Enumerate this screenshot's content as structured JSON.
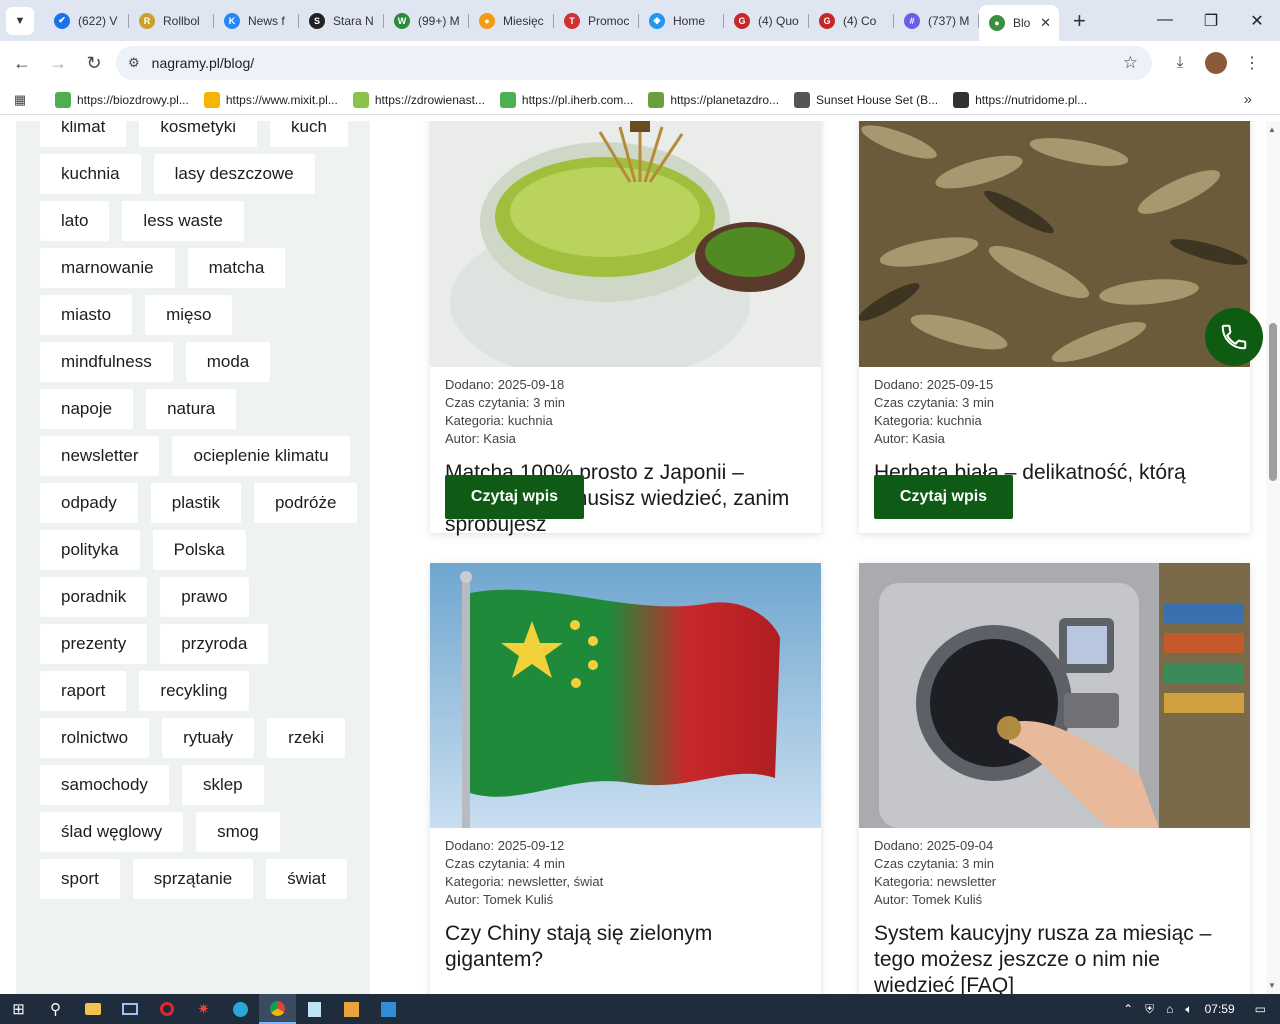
{
  "browser": {
    "tabs": [
      {
        "label": "(622) V",
        "color": "#1a73e8",
        "glyph": "✔"
      },
      {
        "label": "Rollbol",
        "color": "#c9a227",
        "glyph": "R"
      },
      {
        "label": "News f",
        "color": "#2787f5",
        "glyph": "K"
      },
      {
        "label": "Stara N",
        "color": "#222222",
        "glyph": "S"
      },
      {
        "label": "(99+) M",
        "color": "#2a8c3c",
        "glyph": "W"
      },
      {
        "label": "Miesięc",
        "color": "#f39c12",
        "glyph": "●"
      },
      {
        "label": "Promoc",
        "color": "#d32f2f",
        "glyph": "T"
      },
      {
        "label": "Home",
        "color": "#2196f3",
        "glyph": "◆"
      },
      {
        "label": "(4) Quo",
        "color": "#c62828",
        "glyph": "G"
      },
      {
        "label": "(4) Co",
        "color": "#c62828",
        "glyph": "G"
      },
      {
        "label": "(737) M",
        "color": "#6c5ce7",
        "glyph": "#"
      }
    ],
    "active_tab": {
      "label": "Blo",
      "color": "#3e8e41",
      "glyph": "●"
    },
    "address": "nagramy.pl/blog/",
    "bookmarks": [
      {
        "label": "https://biozdrowy.pl...",
        "color": "#4caf50"
      },
      {
        "label": "https://www.mixit.pl...",
        "color": "#f4b400"
      },
      {
        "label": "https://zdrowienast...",
        "color": "#8bc34a"
      },
      {
        "label": "https://pl.iherb.com...",
        "color": "#4caf50"
      },
      {
        "label": "https://planetazdro...",
        "color": "#689f38"
      },
      {
        "label": "Sunset House Set (B...",
        "color": "#555555"
      },
      {
        "label": "https://nutridome.pl...",
        "color": "#333333"
      }
    ]
  },
  "sidebar": {
    "tags": [
      "klimat",
      "kosmetyki",
      "kuch",
      "kuchnia",
      "lasy deszczowe",
      "lato",
      "less waste",
      "marnowanie",
      "matcha",
      "miasto",
      "mięso",
      "mindfulness",
      "moda",
      "napoje",
      "natura",
      "newsletter",
      "ocieplenie klimatu",
      "odpady",
      "plastik",
      "podróże",
      "polityka",
      "Polska",
      "poradnik",
      "prawo",
      "prezenty",
      "przyroda",
      "raport",
      "recykling",
      "rolnictwo",
      "rytuały",
      "rzeki",
      "samochody",
      "sklep",
      "ślad węglowy",
      "smog",
      "sport",
      "sprzątanie",
      "świat"
    ]
  },
  "posts": [
    {
      "date": "Dodano: 2025-09-18",
      "read_time": "Czas czytania: 3 min",
      "category": "Kategoria: kuchnia",
      "author": "Autor: Kasia",
      "title": "Matcha 100% prosto z Japonii – wszystko, co musisz wiedzieć, zanim spróbujesz",
      "button": "Czytaj wpis"
    },
    {
      "date": "Dodano: 2025-09-15",
      "read_time": "Czas czytania: 3 min",
      "category": "Kategoria: kuchnia",
      "author": "Autor: Kasia",
      "title": "Herbata biała – delikatność, którą warto odkryć",
      "button": "Czytaj wpis"
    },
    {
      "date": "Dodano: 2025-09-12",
      "read_time": "Czas czytania: 4 min",
      "category": "Kategoria: newsletter, świat",
      "author": "Autor: Tomek Kuliś",
      "title": "Czy Chiny stają się zielonym gigantem?"
    },
    {
      "date": "Dodano: 2025-09-04",
      "read_time": "Czas czytania: 3 min",
      "category": "Kategoria: newsletter",
      "author": "Autor: Tomek Kuliś",
      "title": "System kaucyjny rusza za miesiąc – tego możesz jeszcze o nim nie wiedzieć [FAQ]"
    }
  ],
  "taskbar": {
    "time": "07:59"
  }
}
